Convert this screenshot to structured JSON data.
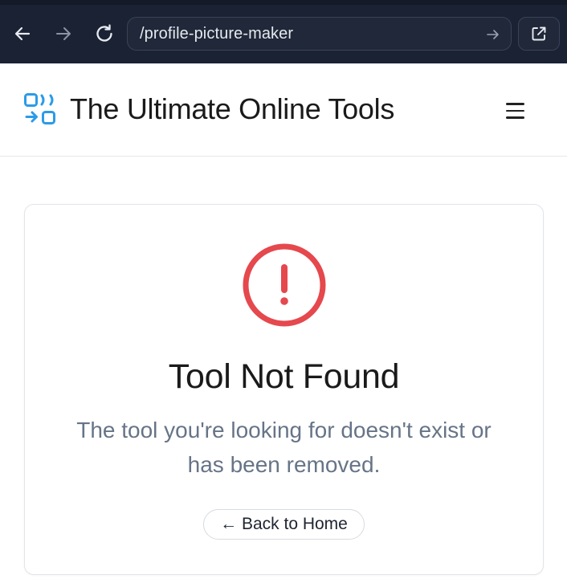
{
  "browser": {
    "url": "/profile-picture-maker",
    "back_icon": "arrow-left-icon",
    "forward_icon": "arrow-right-icon",
    "reload_icon": "reload-icon",
    "external_icon": "external-link-icon"
  },
  "header": {
    "title": "The Ultimate Online Tools",
    "logo_icon": "swap-tools-logo-icon",
    "menu_icon": "hamburger-menu-icon",
    "logo_color": "#2b9be8"
  },
  "error_card": {
    "icon": "alert-circle-icon",
    "icon_color": "#e5484d",
    "title": "Tool Not Found",
    "message": "The tool you're looking for doesn't exist or has been removed.",
    "button_label": "← Back to Home"
  }
}
